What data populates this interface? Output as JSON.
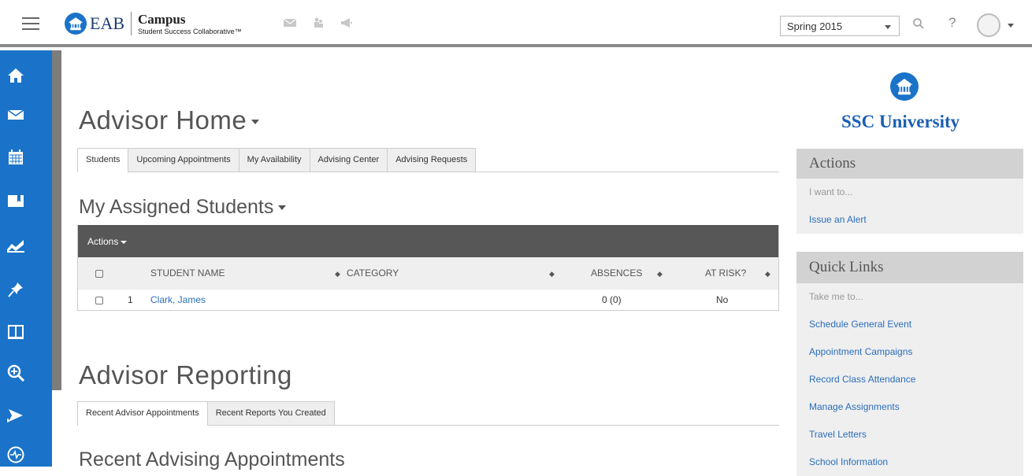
{
  "topbar": {
    "brand_eab": "EAB",
    "brand_campus": "Campus",
    "brand_sub": "Student Success Collaborative™",
    "term": "Spring 2015",
    "help": "?"
  },
  "main": {
    "title": "Advisor Home",
    "tabs": [
      "Students",
      "Upcoming Appointments",
      "My Availability",
      "Advising Center",
      "Advising Requests"
    ],
    "assigned_title": "My Assigned Students",
    "table": {
      "actions_label": "Actions",
      "headers": {
        "name": "STUDENT NAME",
        "category": "CATEGORY",
        "absences": "ABSENCES",
        "at_risk": "AT RISK?"
      },
      "rows": [
        {
          "num": "1",
          "name": "Clark, James",
          "category": "",
          "absences": "0 (0)",
          "at_risk": "No"
        }
      ]
    },
    "reporting_title": "Advisor Reporting",
    "reporting_tabs": [
      "Recent Advisor Appointments",
      "Recent Reports You Created"
    ],
    "recent_title": "Recent Advising Appointments"
  },
  "sidebar_right": {
    "university": "SSC University",
    "actions": {
      "title": "Actions",
      "subtitle": "I want to...",
      "links": [
        "Issue an Alert"
      ]
    },
    "quick_links": {
      "title": "Quick Links",
      "subtitle": "Take me to...",
      "links": [
        "Schedule General Event",
        "Appointment Campaigns",
        "Record Class Attendance",
        "Manage Assignments",
        "Travel Letters",
        "School Information"
      ]
    }
  },
  "colors": {
    "brand_blue": "#1a73c8",
    "link": "#2a6ebb",
    "toolbar_dark": "#575757"
  },
  "icons": {
    "leftnav": [
      "home-icon",
      "mail-icon",
      "calendar-icon",
      "folder-icon",
      "chart-icon",
      "pin-icon",
      "book-icon",
      "search-zoom-icon",
      "plane-icon",
      "pulse-icon"
    ]
  }
}
